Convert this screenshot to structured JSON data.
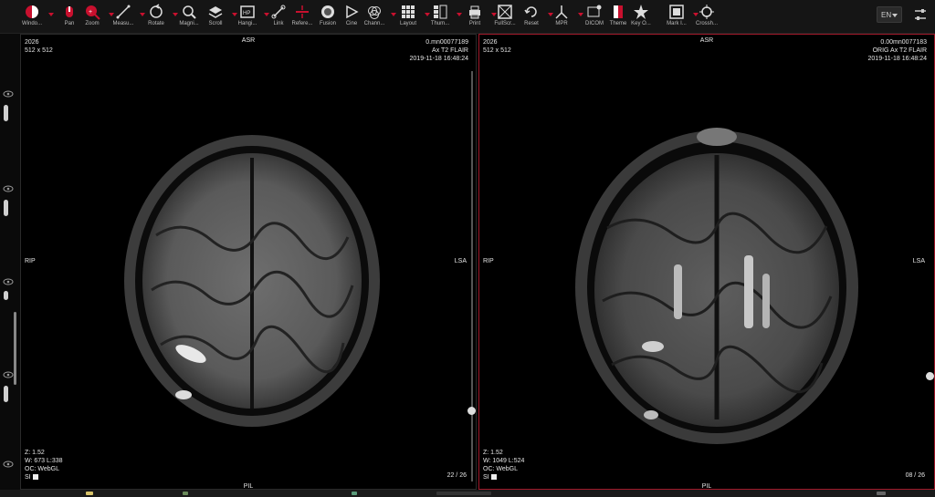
{
  "toolbar": {
    "tools": [
      {
        "name": "window-level",
        "label": "Windo...",
        "icon": "window-level-icon",
        "caret": true
      },
      {
        "name": "pan",
        "label": "Pan",
        "icon": "pan-icon",
        "caret": false
      },
      {
        "name": "zoom",
        "label": "Zoom",
        "icon": "zoom-icon",
        "caret": true
      },
      {
        "name": "measure",
        "label": "Measu...",
        "icon": "measure-icon",
        "caret": true
      },
      {
        "name": "rotate",
        "label": "Rotate",
        "icon": "rotate-icon",
        "caret": true
      },
      {
        "name": "magnify",
        "label": "Magni...",
        "icon": "magnify-icon",
        "caret": false
      },
      {
        "name": "scroll",
        "label": "Scroll",
        "icon": "scroll-icon",
        "caret": true
      },
      {
        "name": "hanging",
        "label": "Hangi...",
        "icon": "hanging-icon",
        "caret": true
      },
      {
        "name": "link",
        "label": "Link",
        "icon": "link-icon",
        "caret": false
      },
      {
        "name": "reference",
        "label": "Refere...",
        "icon": "reference-icon",
        "caret": false
      },
      {
        "name": "fusion",
        "label": "Fusion",
        "icon": "fusion-icon",
        "caret": false
      },
      {
        "name": "cine",
        "label": "Cine",
        "icon": "cine-icon",
        "caret": false
      },
      {
        "name": "channel",
        "label": "Chann...",
        "icon": "channel-icon",
        "caret": true
      },
      {
        "name": "layout",
        "label": "Layout",
        "icon": "layout-icon",
        "caret": true
      },
      {
        "name": "thumbnails",
        "label": "Thum...",
        "icon": "thumbnails-icon",
        "caret": true
      },
      {
        "name": "print",
        "label": "Print",
        "icon": "print-icon",
        "caret": true
      },
      {
        "name": "fullscreen",
        "label": "FullScr...",
        "icon": "fullscreen-icon",
        "caret": false
      },
      {
        "name": "reset",
        "label": "Reset",
        "icon": "reset-icon",
        "caret": true
      },
      {
        "name": "mpr",
        "label": "MPR",
        "icon": "mpr-icon",
        "caret": true
      },
      {
        "name": "dicom",
        "label": "DICOM",
        "icon": "dicom-icon",
        "caret": false
      },
      {
        "name": "theme",
        "label": "Theme",
        "icon": "theme-icon",
        "caret": false
      },
      {
        "name": "key-object",
        "label": "Key O...",
        "icon": "star-icon",
        "caret": false
      },
      {
        "name": "mark",
        "label": "Mark I...",
        "icon": "mark-icon",
        "caret": true
      },
      {
        "name": "crosshair",
        "label": "Crossh...",
        "icon": "crosshair-icon",
        "caret": false
      }
    ],
    "language": "EN"
  },
  "viewports": [
    {
      "top_left": [
        "2026",
        "512 x 512"
      ],
      "top_right": [
        "0.mn00077189",
        "Ax T2 FLAIR",
        "2019-11-18 16:48:24"
      ],
      "bottom_left": [
        "Z: 1.52",
        "W: 673 L:338",
        "OC: WebGL"
      ],
      "bottom_left_si": "SI",
      "bottom_right": "22 / 26",
      "orient_top": "ASR",
      "orient_bottom": "PIL",
      "orient_left": "RIP",
      "orient_right": "LSA",
      "active": false
    },
    {
      "top_left": [
        "2026",
        "512 x 512"
      ],
      "top_right": [
        "0.00mn0077183",
        "ORIG Ax T2 FLAIR",
        "2019-11-18 16:48:24"
      ],
      "bottom_left": [
        "Z: 1.52",
        "W: 1049 L:524",
        "OC: WebGL"
      ],
      "bottom_left_si": "SI",
      "bottom_right": "08 / 26",
      "orient_top": "ASR",
      "orient_bottom": "PIL",
      "orient_left": "RIP",
      "orient_right": "LSA",
      "active": true
    }
  ],
  "colors": {
    "accent": "#c8102e",
    "active_border": "#a0192a"
  }
}
